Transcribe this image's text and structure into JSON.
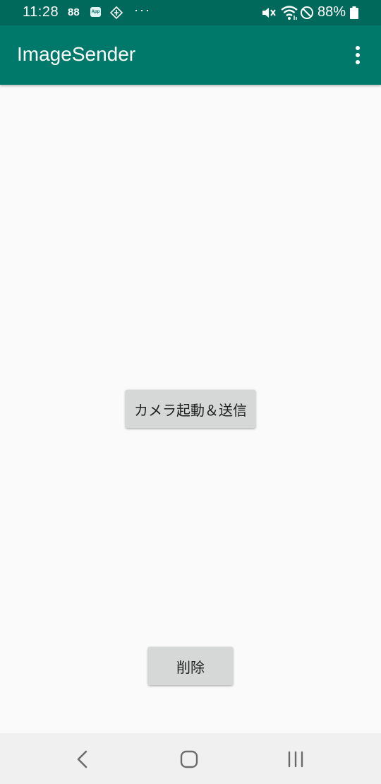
{
  "status_bar": {
    "time": "11:28",
    "notif_88": "88",
    "app_badge": "App",
    "more": "···",
    "battery": "88%",
    "icons": [
      "game-icon",
      "app-icon",
      "direction-icon",
      "mute-icon",
      "wifi-icon",
      "do-not-disturb-icon",
      "battery-icon"
    ]
  },
  "app_bar": {
    "title": "ImageSender",
    "overflow_icon": "more-vert-icon"
  },
  "main": {
    "camera_button_label": "カメラ起動＆送信",
    "delete_button_label": "削除"
  },
  "nav_bar": {
    "icons": [
      "back-icon",
      "home-icon",
      "recents-icon"
    ]
  },
  "colors": {
    "status_bar": "#00695c",
    "app_bar": "#00796b",
    "background": "#fafafa",
    "button": "#d6d7d7",
    "nav_bar": "#f0f0f0"
  }
}
